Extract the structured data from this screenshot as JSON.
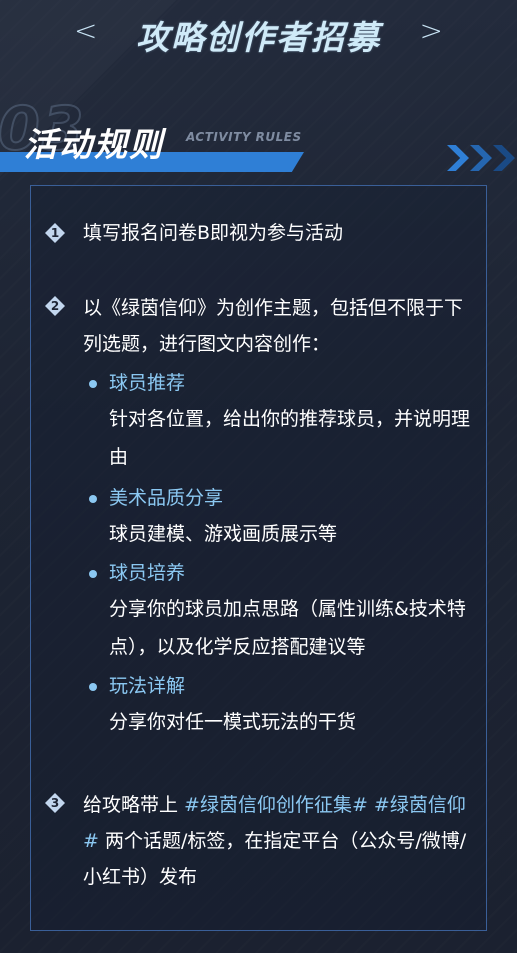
{
  "header": {
    "prev_label": "<",
    "title": "攻略创作者招募",
    "next_label": ">"
  },
  "section": {
    "number": "03",
    "title": "活动规则",
    "subtitle": "ACTIVITY RULES"
  },
  "colors": {
    "accent": "#2f7fd6",
    "highlight": "#8bc8f2",
    "background": "#1e2535"
  },
  "rules": [
    {
      "num": "1",
      "text": "填写报名问卷B即视为参与活动"
    },
    {
      "num": "2",
      "text": "以《绿茵信仰》为创作主题，包括但不限于下列选题，进行图文内容创作："
    },
    {
      "num": "3",
      "text_before": "给攻略带上 ",
      "tags": "#绿茵信仰创作征集# #绿茵信仰#",
      "text_after": " 两个话题/标签，在指定平台（公众号/微博/小红书）发布"
    }
  ],
  "topics": [
    {
      "title": "球员推荐",
      "desc": "针对各位置，给出你的推荐球员，并说明理由"
    },
    {
      "title": "美术品质分享",
      "desc": "球员建模、游戏画质展示等"
    },
    {
      "title": "球员培养",
      "desc": "分享你的球员加点思路（属性训练&技术特点），以及化学反应搭配建议等"
    },
    {
      "title": "玩法详解",
      "desc": "分享你对任一模式玩法的干货"
    }
  ]
}
